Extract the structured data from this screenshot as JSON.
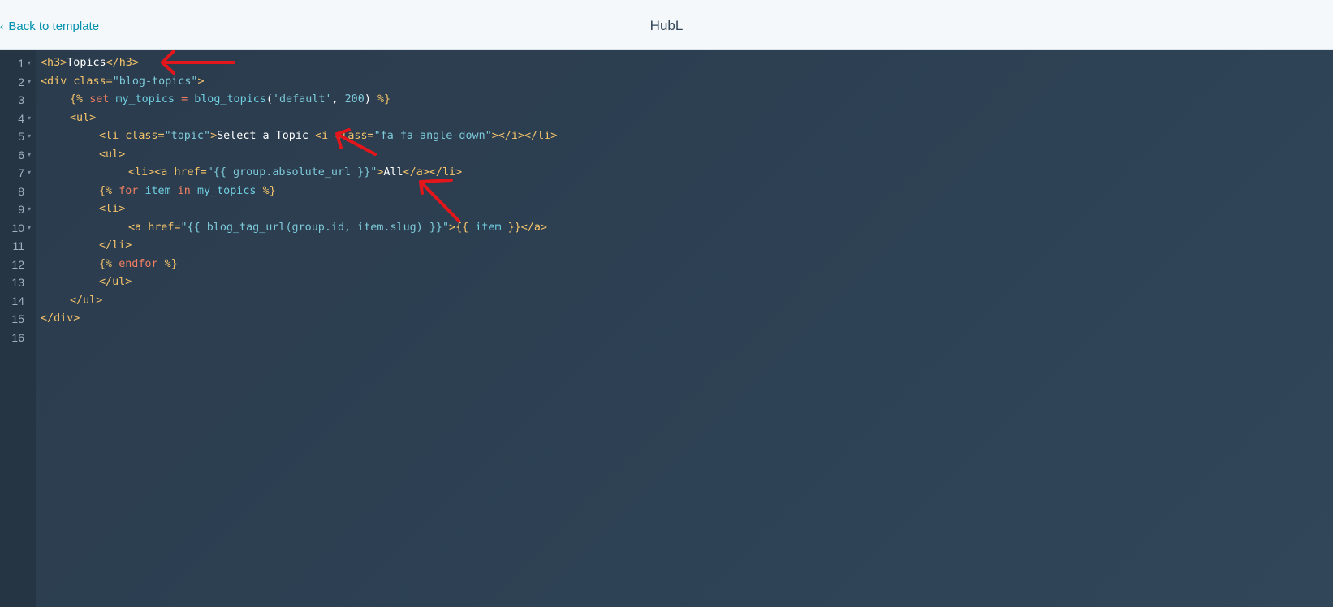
{
  "header": {
    "back_label": "Back to template",
    "title": "HubL"
  },
  "code_lines": [
    {
      "n": "1",
      "fold": true,
      "indent": 0,
      "tokens": [
        [
          "t-tag",
          "<h3>"
        ],
        [
          "t-txt",
          "Topics"
        ],
        [
          "t-tag",
          "</h3>"
        ]
      ]
    },
    {
      "n": "2",
      "fold": true,
      "indent": 0,
      "tokens": [
        [
          "t-tag",
          "<div "
        ],
        [
          "t-attr",
          "class="
        ],
        [
          "t-str",
          "\"blog-topics\""
        ],
        [
          "t-tag",
          ">"
        ]
      ]
    },
    {
      "n": "3",
      "fold": false,
      "indent": 1,
      "tokens": [
        [
          "t-delim",
          "{% "
        ],
        [
          "t-kw",
          "set "
        ],
        [
          "t-var",
          "my_topics "
        ],
        [
          "t-kw",
          "= "
        ],
        [
          "t-var",
          "blog_topics"
        ],
        [
          "t-txt",
          "("
        ],
        [
          "t-str",
          "'default'"
        ],
        [
          "t-txt",
          ", "
        ],
        [
          "t-str",
          "200"
        ],
        [
          "t-txt",
          ") "
        ],
        [
          "t-delim",
          "%}"
        ]
      ]
    },
    {
      "n": "4",
      "fold": true,
      "indent": 1,
      "tokens": [
        [
          "t-tag",
          "<ul>"
        ]
      ]
    },
    {
      "n": "5",
      "fold": true,
      "indent": 2,
      "tokens": [
        [
          "t-tag",
          "<li "
        ],
        [
          "t-attr",
          "class="
        ],
        [
          "t-str",
          "\"topic\""
        ],
        [
          "t-tag",
          ">"
        ],
        [
          "t-txt",
          "Select a Topic "
        ],
        [
          "t-tag",
          "<i "
        ],
        [
          "t-attr",
          "class="
        ],
        [
          "t-str",
          "\"fa fa-angle-down\""
        ],
        [
          "t-tag",
          "></i></li>"
        ]
      ]
    },
    {
      "n": "6",
      "fold": true,
      "indent": 2,
      "tokens": [
        [
          "t-tag",
          "<ul>"
        ]
      ]
    },
    {
      "n": "7",
      "fold": true,
      "indent": 3,
      "tokens": [
        [
          "t-tag",
          "<li><a "
        ],
        [
          "t-attr",
          "href="
        ],
        [
          "t-str",
          "\"{{ group.absolute_url }}\""
        ],
        [
          "t-tag",
          ">"
        ],
        [
          "t-txt",
          "All"
        ],
        [
          "t-tag",
          "</a></li>"
        ]
      ]
    },
    {
      "n": "8",
      "fold": false,
      "indent": 2,
      "tokens": [
        [
          "t-delim",
          "{% "
        ],
        [
          "t-kw",
          "for "
        ],
        [
          "t-var",
          "item "
        ],
        [
          "t-kw",
          "in "
        ],
        [
          "t-var",
          "my_topics "
        ],
        [
          "t-delim",
          "%}"
        ]
      ]
    },
    {
      "n": "9",
      "fold": true,
      "indent": 2,
      "tokens": [
        [
          "t-tag",
          "<li>"
        ]
      ]
    },
    {
      "n": "10",
      "fold": true,
      "indent": 3,
      "tokens": [
        [
          "t-tag",
          "<a "
        ],
        [
          "t-attr",
          "href="
        ],
        [
          "t-str",
          "\"{{ blog_tag_url(group.id, item.slug) }}\""
        ],
        [
          "t-tag",
          ">"
        ],
        [
          "t-delim",
          "{{ "
        ],
        [
          "t-var",
          "item "
        ],
        [
          "t-delim",
          "}}"
        ],
        [
          "t-tag",
          "</a>"
        ]
      ]
    },
    {
      "n": "11",
      "fold": false,
      "indent": 2,
      "tokens": [
        [
          "t-tag",
          "</li>"
        ]
      ]
    },
    {
      "n": "12",
      "fold": false,
      "indent": 2,
      "tokens": [
        [
          "t-delim",
          "{% "
        ],
        [
          "t-kw",
          "endfor "
        ],
        [
          "t-delim",
          "%}"
        ]
      ]
    },
    {
      "n": "13",
      "fold": false,
      "indent": 2,
      "tokens": [
        [
          "t-tag",
          "</ul>"
        ]
      ]
    },
    {
      "n": "14",
      "fold": false,
      "indent": 1,
      "tokens": [
        [
          "t-tag",
          "</ul>"
        ]
      ]
    },
    {
      "n": "15",
      "fold": false,
      "indent": 0,
      "tokens": [
        [
          "t-tag",
          "</div>"
        ]
      ]
    },
    {
      "n": "16",
      "fold": false,
      "indent": 0,
      "tokens": []
    }
  ],
  "colors": {
    "editor_bg": "#2b3e50",
    "annotation_arrow": "#e3161b",
    "link": "#0091ae"
  },
  "icons": {
    "back": "chevron-left-icon",
    "fold": "fold-triangle-icon"
  }
}
